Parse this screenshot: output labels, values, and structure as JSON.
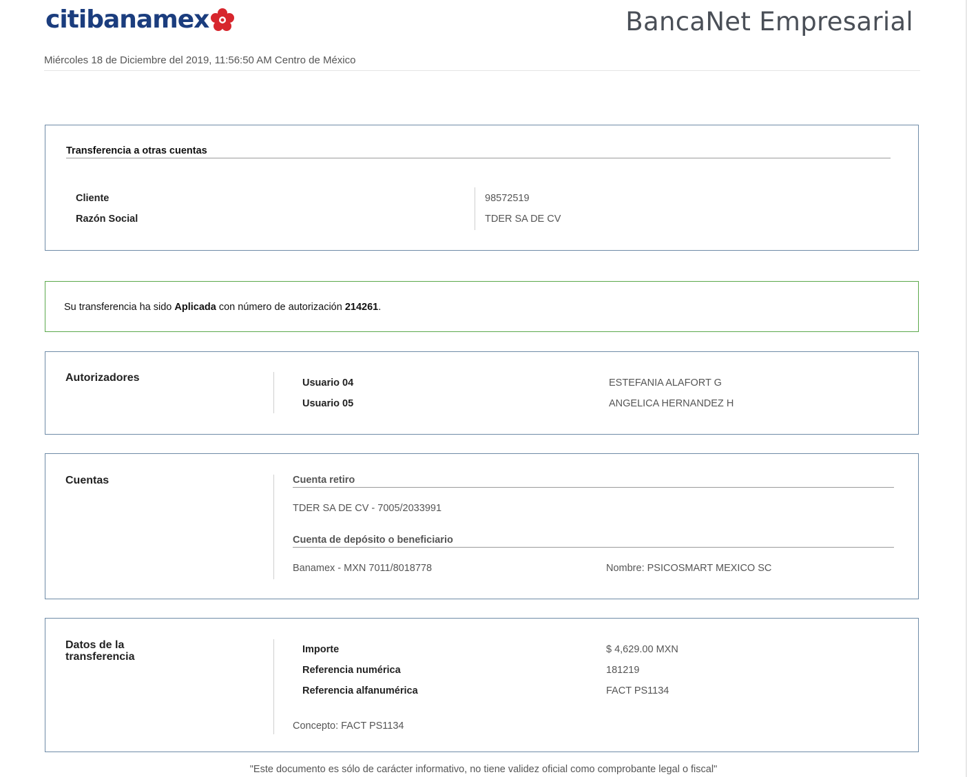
{
  "header": {
    "brand": "citibanamex",
    "product": "BancaNet Empresarial",
    "datetime": "Miércoles 18 de Diciembre del 2019, 11:56:50 AM Centro de México"
  },
  "transfer_header": {
    "title": "Transferencia a otras cuentas",
    "rows": [
      {
        "label": "Cliente",
        "value": "98572519"
      },
      {
        "label": "Razón Social",
        "value": "TDER SA DE CV"
      }
    ]
  },
  "status": {
    "prefix": "Su transferencia ha sido ",
    "state": "Aplicada",
    "middle": " con número de autorización ",
    "auth_number": "214261",
    "suffix": "."
  },
  "autorizadores": {
    "title": "Autorizadores",
    "rows": [
      {
        "label": "Usuario 04",
        "value": "ESTEFANIA ALAFORT G"
      },
      {
        "label": "Usuario 05",
        "value": "ANGELICA HERNANDEZ H"
      }
    ]
  },
  "cuentas": {
    "title": "Cuentas",
    "retiro_label": "Cuenta retiro",
    "retiro_value": "TDER SA DE CV - 7005/2033991",
    "deposito_label": "Cuenta de depósito o beneficiario",
    "deposito_value": "Banamex - MXN 7011/8018778",
    "deposito_name": "Nombre: PSICOSMART MEXICO SC"
  },
  "datos": {
    "title_line1": "Datos de la",
    "title_line2": "transferencia",
    "rows": [
      {
        "label": "Importe",
        "value": "$ 4,629.00 MXN"
      },
      {
        "label": "Referencia numérica",
        "value": "181219"
      },
      {
        "label": "Referencia alfanumérica",
        "value": "FACT PS1134"
      }
    ],
    "concepto": "Concepto: FACT PS1134"
  },
  "footer": "\"Este documento es sólo de carácter informativo, no tiene validez oficial como comprobante legal o fiscal\"",
  "colors": {
    "brand_blue": "#1b3d7e",
    "brand_red": "#d7262d",
    "box_border": "#6d8aa6",
    "success_border": "#5aa84a"
  },
  "icons": {
    "brand_flower": "banamex-flower-icon"
  }
}
